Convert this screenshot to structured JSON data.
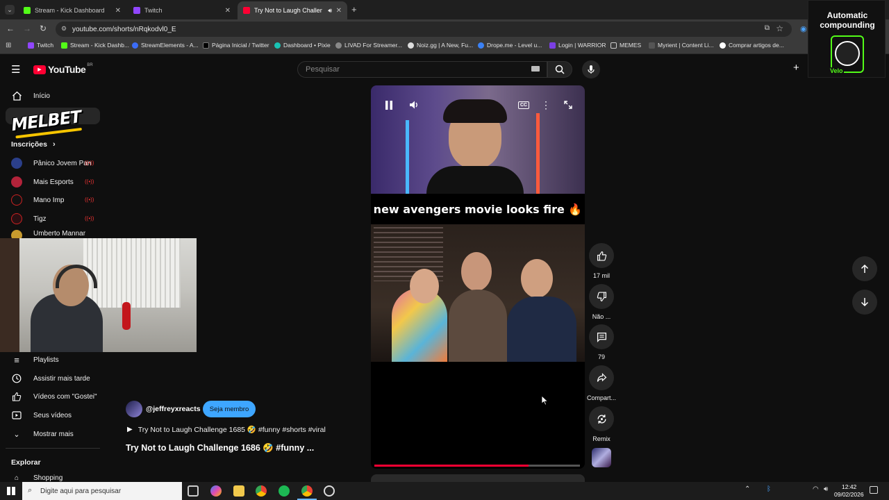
{
  "browser": {
    "tabs": [
      {
        "title": "Stream - Kick Dashboard",
        "color": "#53fc18"
      },
      {
        "title": "Twitch",
        "color": "#9146ff"
      },
      {
        "title": "Try Not to Laugh Challeng",
        "color": "#ff0033"
      }
    ],
    "url": "youtube.com/shorts/nRqkodvl0_E",
    "bookmarks": [
      "Twitch",
      "Stream - Kick Dashb...",
      "StreamElements - A...",
      "Página Inicial / Twitter",
      "Dashboard • Pixie",
      "LIVAD For Streamer...",
      "Noiz.gg | A New, Fu...",
      "Drope.me - Level u...",
      "Login | WARRIOR",
      "MEMES",
      "Myrient | Content Li...",
      "Comprar artigos de..."
    ]
  },
  "youtube": {
    "logo": "YouTube",
    "region": "BR",
    "search_placeholder": "Pesquisar",
    "sidebar": {
      "home": "Início",
      "subscriptions_header": "Inscrições",
      "channels": [
        "Pânico Jovem Pan",
        "Mais Esports",
        "Mano Imp",
        "Tigz",
        "Umberto Mannar"
      ],
      "library": [
        "Playlists",
        "Assistir mais tarde",
        "Vídeos com \"Gostei\"",
        "Seus vídeos",
        "Mostrar mais"
      ],
      "explore_header": "Explorar",
      "shopping": "Shopping"
    },
    "short": {
      "caption": "new avengers movie looks fire 🔥",
      "progress": 0.75,
      "channel": "@jeffreyxreacts",
      "join_label": "Seja membro",
      "prev_title": "Try Not to Laugh Challenge 1685 🤣 #funny #shorts #viral",
      "title": "Try Not to Laugh Challenge 1686 🤣 #funny ...",
      "likes": "17 mil",
      "dislike_label": "Não ...",
      "comments": "79",
      "share_label": "Compart...",
      "remix_label": "Remix"
    }
  },
  "overlay": {
    "sponsor": "MELBET",
    "promo_line1": "Automatic",
    "promo_line2": "compounding",
    "promo_brand": "Velo"
  },
  "taskbar": {
    "search_placeholder": "Digite aqui para pesquisar",
    "time": "12:42",
    "date": "09/02/2026"
  }
}
